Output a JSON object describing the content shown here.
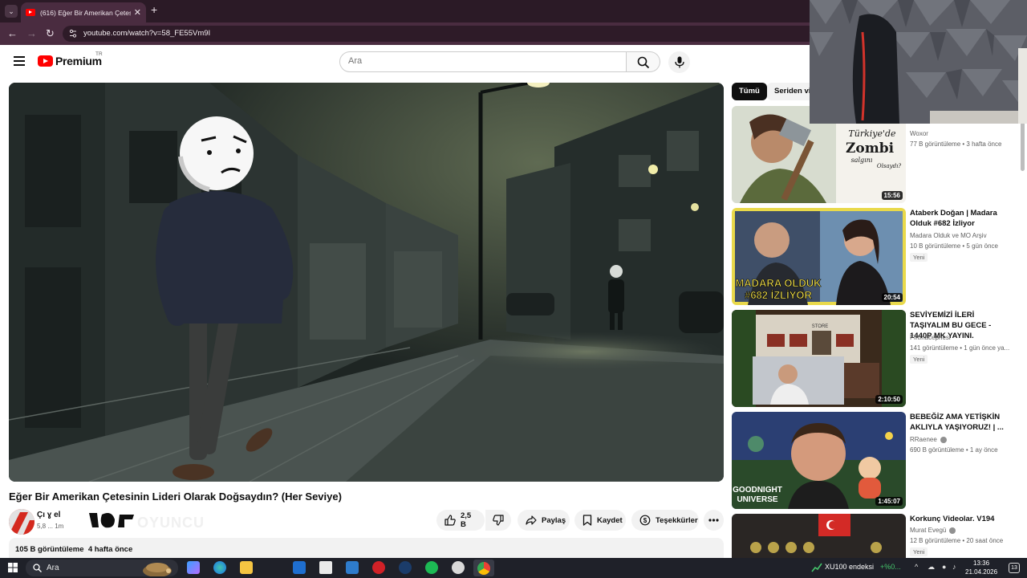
{
  "browser": {
    "tab_title": "(616) Eğer Bir Amerikan Çetesinin",
    "url": "youtube.com/watch?v=58_FE55Vm9I"
  },
  "masthead": {
    "logo_text": "Premium",
    "country_code": "TR",
    "search_placeholder": "Ara"
  },
  "video": {
    "title": "Eğer Bir Amerikan Çetesinin Lideri Olarak Doğsaydın? (Her Seviye)",
    "channel_name": "Çı ɣ el",
    "channel_subs": "5,8 ... 1m",
    "like_count": "2,5 B",
    "share_label": "Paylaş",
    "save_label": "Kaydet",
    "thanks_label": "Teşekkürler",
    "views": "105 B görüntüleme",
    "age": "4 hafta önce",
    "watermark": "OYUNCU"
  },
  "chips": [
    "Tümü",
    "Seriden videolar"
  ],
  "recommendations": [
    {
      "title": "",
      "channel": "Woxor",
      "views": "77 B görüntüleme",
      "age": "3 hafta önce",
      "duration": "15:56",
      "badge": "",
      "verified": false,
      "thumb_text_1": "Türkiye'de",
      "thumb_text_2": "Zombi",
      "thumb_text_3": "salgını",
      "thumb_text_4": "Olsaydı?"
    },
    {
      "title": "Ataberk Doğan | Madara Olduk #682 İzliyor",
      "channel": "Madara Olduk ve MO Arşiv",
      "views": "10 B görüntüleme",
      "age": "5 gün önce",
      "duration": "20:54",
      "badge": "Yeni",
      "verified": false,
      "thumb_text_1": "MADARA OLDUK",
      "thumb_text_2": "#682 İZLİYOR"
    },
    {
      "title": "SEVİYEMİZİ İLERİ TAŞIYALIM BU GECE - 1440P MK YAYINI.",
      "channel": "Fırtınacephesi",
      "views": "141 görüntüleme",
      "age": "1 gün önce ya...",
      "duration": "2:10:50",
      "badge": "Yeni",
      "verified": false,
      "thumb_text_1": "STORE"
    },
    {
      "title": "BEBEĞİZ AMA YETİŞKİN AKLIYLA YAŞIYORUZ! | ...",
      "channel": "RRaenee",
      "views": "690 B görüntüleme",
      "age": "1 ay önce",
      "duration": "1:45:07",
      "badge": "",
      "verified": true,
      "thumb_text_1": "GOODNIGHT",
      "thumb_text_2": "UNIVERSE"
    },
    {
      "title": "Korkunç Videolar. V194",
      "channel": "Murat Evegü",
      "views": "12 B görüntüleme",
      "age": "20 saat önce",
      "duration": "",
      "badge": "Yeni",
      "verified": true
    }
  ],
  "taskbar": {
    "search_text": "Ara",
    "stock_name": "XU100 endeksi",
    "stock_change": "+%0...",
    "time": "13:36",
    "date": "21.04.2026",
    "notif_count": "13"
  },
  "colors": {
    "tab_bar": "#2b1a26",
    "address_bar": "#4a2c40",
    "youtube_red": "#ff0000",
    "taskbar": "#1f2129"
  }
}
